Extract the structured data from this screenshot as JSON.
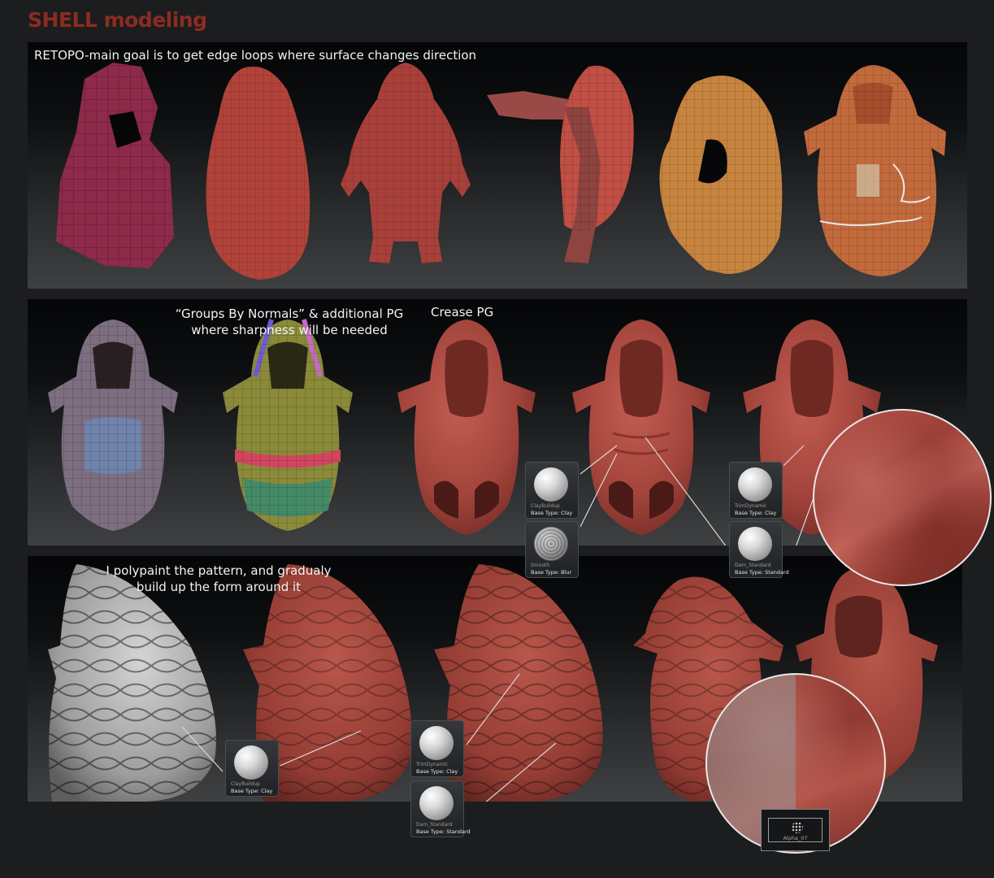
{
  "title": "SHELL modeling",
  "panel1": {
    "caption": "RETOPO-main goal is to get edge loops where surface changes direction"
  },
  "panel2": {
    "caption_line1": "“Groups By Normals” & additional PG",
    "caption_line2": "where sharpness will be needed",
    "caption_crease": "Crease PG"
  },
  "panel3": {
    "caption_line1": "I polypaint the pattern, and gradualy",
    "caption_line2": "build up the form around it"
  },
  "brushes": [
    {
      "name": "ClayBuildup",
      "type": "Base Type: Clay"
    },
    {
      "name": "Smooth",
      "type": "Base Type: Blur"
    },
    {
      "name": "TrimDynamic",
      "type": "Base Type: Clay"
    },
    {
      "name": "Dam_Standard",
      "type": "Base Type: Standard"
    },
    {
      "name": "ClayBuildup",
      "type": "Base Type: Clay"
    },
    {
      "name": "TrimDynamic",
      "type": "Base Type: Clay"
    },
    {
      "name": "Dam_Standard",
      "type": "Base Type: Standard"
    }
  ],
  "alpha": {
    "label": "Alpha_07"
  },
  "colors": {
    "title": "#8a2d22",
    "clay_red": "#b24a3f",
    "retopo_magenta": "#8e2a4a",
    "retopo_orange": "#c77a3a",
    "sculpt_gray": "#b7b7b7"
  }
}
